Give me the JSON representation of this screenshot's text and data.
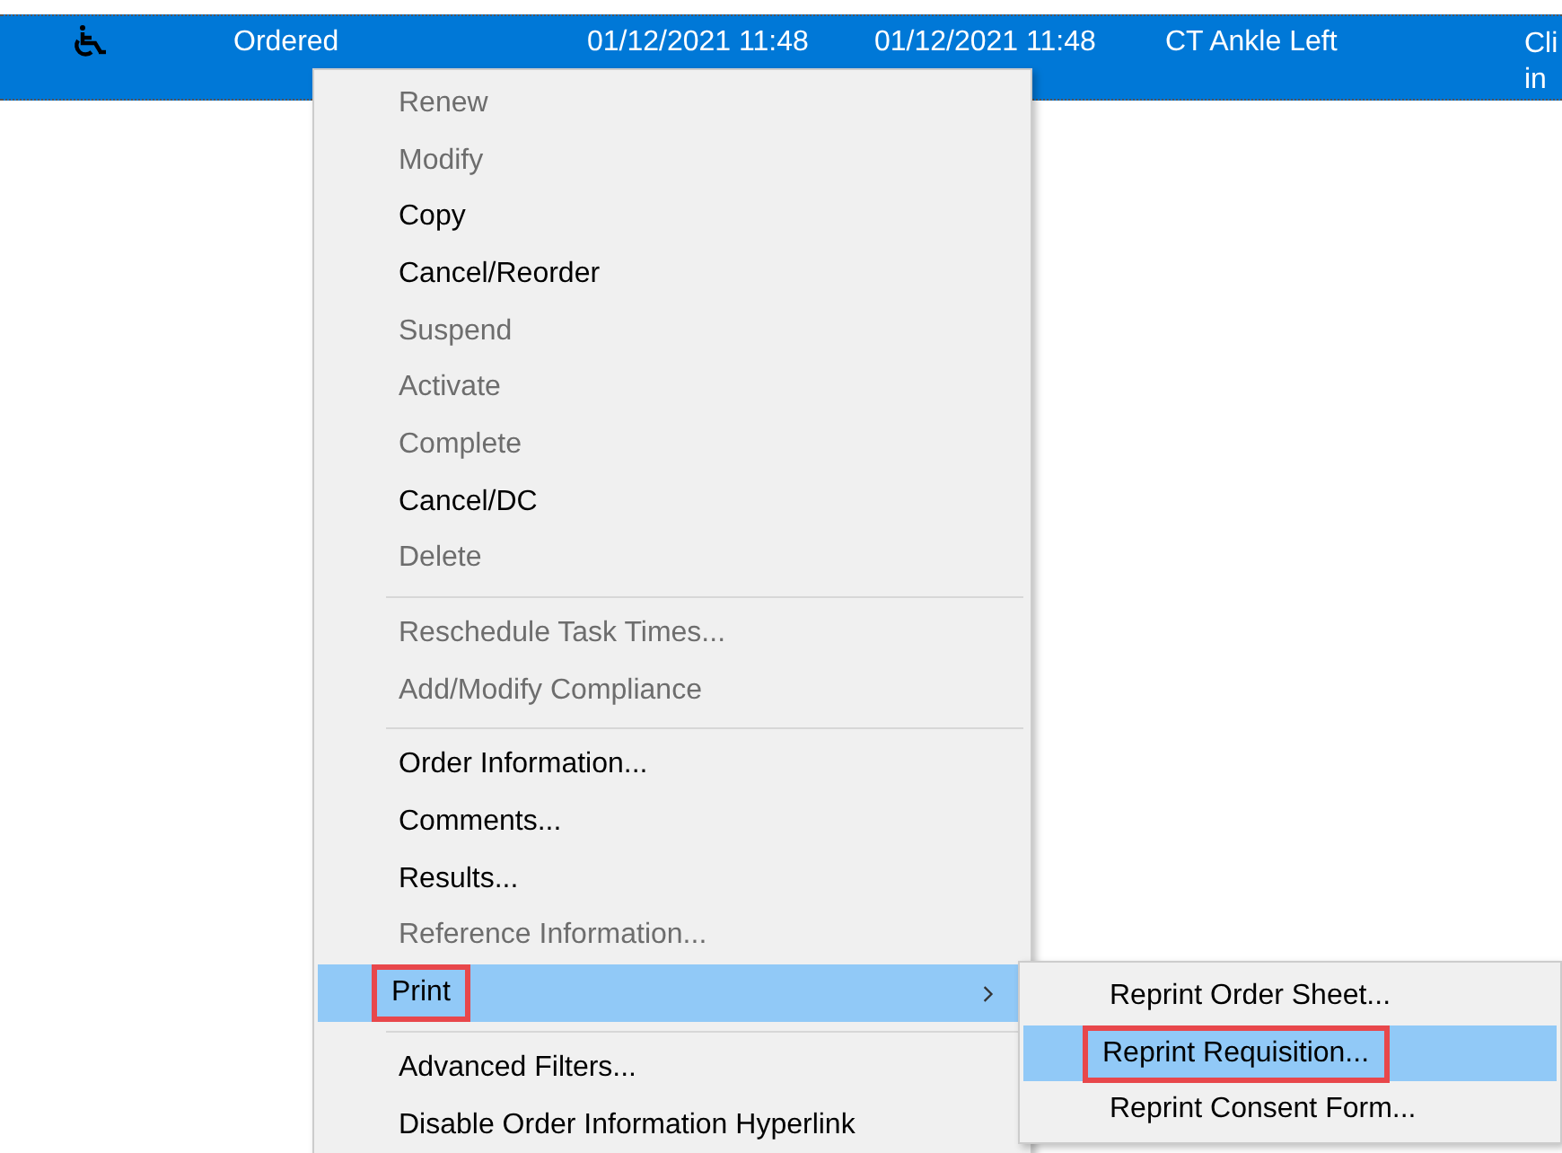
{
  "order_row": {
    "selected": true,
    "status": "Ordered",
    "column_3": "01/12/2021 11:48",
    "column_4": "01/12/2021 11:48",
    "column_5": "CT Ankle Left",
    "column_6": [
      "Cli",
      "in"
    ]
  },
  "context_menu": {
    "items": [
      {
        "kind": "item",
        "label": "Renew",
        "disabled": true,
        "selected": false,
        "outlined": false
      },
      {
        "kind": "item",
        "label": "Modify",
        "disabled": true,
        "selected": false,
        "outlined": false
      },
      {
        "kind": "item",
        "label": "Copy",
        "disabled": false,
        "selected": false,
        "outlined": false
      },
      {
        "kind": "item",
        "label": "Cancel/Reorder",
        "disabled": false,
        "selected": false,
        "outlined": false
      },
      {
        "kind": "item",
        "label": "Suspend",
        "disabled": true,
        "selected": false,
        "outlined": false
      },
      {
        "kind": "item",
        "label": "Activate",
        "disabled": true,
        "selected": false,
        "outlined": false
      },
      {
        "kind": "item",
        "label": "Complete",
        "disabled": true,
        "selected": false,
        "outlined": false
      },
      {
        "kind": "item",
        "label": "Cancel/DC",
        "disabled": false,
        "selected": false,
        "outlined": false
      },
      {
        "kind": "item",
        "label": "Delete",
        "disabled": true,
        "selected": false,
        "outlined": false
      },
      {
        "kind": "separator"
      },
      {
        "kind": "item",
        "label": "Reschedule Task Times...",
        "disabled": true,
        "selected": false,
        "outlined": false
      },
      {
        "kind": "item",
        "label": "Add/Modify Compliance",
        "disabled": true,
        "selected": false,
        "outlined": false
      },
      {
        "kind": "separator"
      },
      {
        "kind": "item",
        "label": "Order Information...",
        "disabled": false,
        "selected": false,
        "outlined": false
      },
      {
        "kind": "item",
        "label": "Comments...",
        "disabled": false,
        "selected": false,
        "outlined": false
      },
      {
        "kind": "item",
        "label": "Results...",
        "disabled": false,
        "selected": false,
        "outlined": false
      },
      {
        "kind": "item",
        "label": "Reference Information...",
        "disabled": true,
        "selected": false,
        "outlined": false
      },
      {
        "kind": "submenu",
        "label": "Print",
        "disabled": false,
        "selected": true,
        "outlined": true
      },
      {
        "kind": "separator"
      },
      {
        "kind": "item",
        "label": "Advanced Filters...",
        "disabled": false,
        "selected": false,
        "outlined": false
      },
      {
        "kind": "item",
        "label": "Disable Order Information Hyperlink",
        "disabled": false,
        "selected": false,
        "outlined": false
      }
    ]
  },
  "submenu": {
    "items": [
      {
        "label": "Reprint Order Sheet...",
        "selected": false,
        "outlined": false
      },
      {
        "label": "Reprint Requisition...",
        "selected": true,
        "outlined": true
      },
      {
        "label": "Reprint Consent Form...",
        "selected": false,
        "outlined": false
      }
    ]
  }
}
